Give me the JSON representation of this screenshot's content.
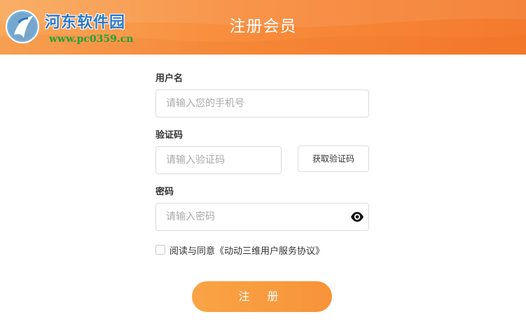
{
  "header": {
    "title": "注册会员"
  },
  "watermark": {
    "name": "河东软件园",
    "url": "www.pc0359.cn"
  },
  "form": {
    "username": {
      "label": "用户名",
      "placeholder": "请输入您的手机号",
      "value": ""
    },
    "code": {
      "label": "验证码",
      "placeholder": "请输入验证码",
      "value": "",
      "button_label": "获取验证码"
    },
    "password": {
      "label": "密码",
      "placeholder": "请输入密码",
      "value": "",
      "toggle_icon": "eye-icon"
    },
    "agreement": {
      "prefix": "阅读与同意",
      "link": "《动动三维用户服务协议》",
      "checked": false
    },
    "submit_label": "注 册"
  },
  "colors": {
    "header_start": "#f9a85a",
    "header_end": "#f47a2c",
    "button": "#f8993f"
  }
}
